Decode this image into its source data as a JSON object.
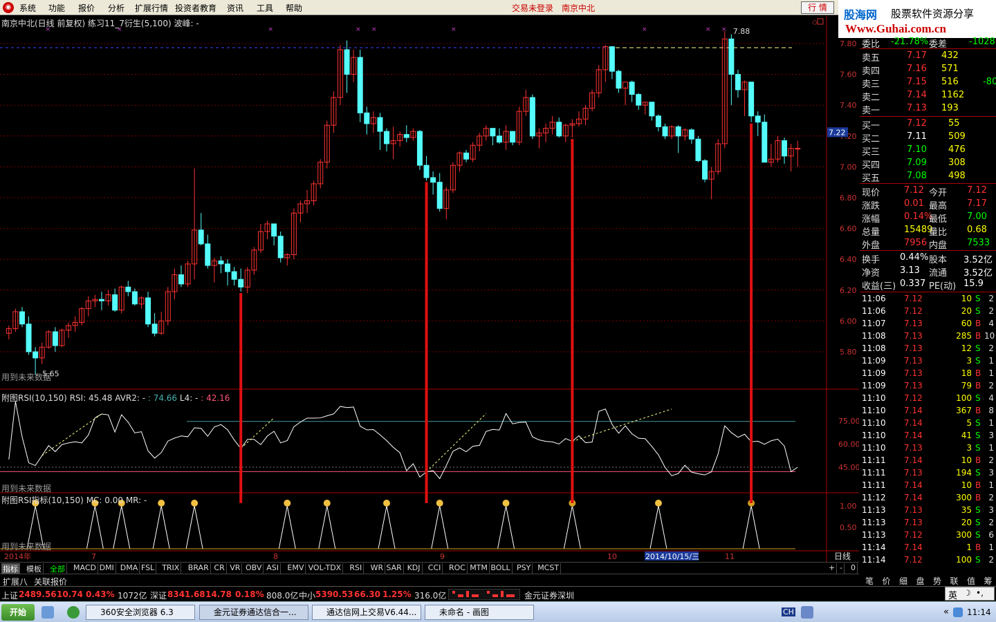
{
  "menubar": {
    "items": [
      "系统",
      "功能",
      "报价",
      "分析",
      "扩展行情",
      "投资者教育",
      "资讯",
      "工具",
      "帮助"
    ],
    "notice_login": "交易未登录",
    "notice_stock": "南京中北",
    "quote_button": "行 情"
  },
  "banner": {
    "site_name": "股海网",
    "slogan": "股票软件资源分享",
    "url": "Www.Guhai.com.cn"
  },
  "chart": {
    "title_stock": "南京中北(日线 前复权)",
    "title_formula": "练习11_7衍生(5,100)",
    "title_wave": "波峰: -",
    "future_note": "用到未来数据",
    "low_label": "5.65",
    "high_label": "7.88",
    "current_price_label": "7.22",
    "price_ticks": [
      "7.80",
      "7.60",
      "7.40",
      "7.20",
      "7.00",
      "6.80",
      "6.60",
      "6.40",
      "6.20",
      "6.00",
      "5.80"
    ],
    "rsi_title": "附图RSI(10,150)",
    "rsi_value_label": "RSI: 45.48",
    "rsi_avr2_label": "AVR2: - ",
    "rsi_avr2_value": ": 74.66",
    "rsi_l4_label": "L4: - ",
    "rsi_l4_value": ": 42.16",
    "rsi_ticks": [
      "75.00",
      "60.00",
      "45.00"
    ],
    "ind_title": "附图RSI指标(10,150)",
    "ind_mc": "MC: 0.00",
    "ind_mr": "MR: -",
    "ind_ticks": [
      "1.00",
      "0.50"
    ],
    "date_axis": [
      "2014年",
      "7",
      "8",
      "9",
      "10",
      "2014/10/15/三",
      "11"
    ],
    "period_label": "日线",
    "colors": {
      "up": "#ff3232",
      "down": "#54fcfc",
      "signal_line": "#e01010",
      "grid": "#7a0000"
    }
  },
  "chart_data": {
    "type": "candlestick",
    "candles": [
      [
        5.92,
        5.97,
        5.88,
        5.95
      ],
      [
        5.95,
        6.08,
        5.93,
        6.06
      ],
      [
        6.06,
        6.09,
        5.96,
        5.98
      ],
      [
        5.98,
        6.03,
        5.78,
        5.8
      ],
      [
        5.8,
        5.83,
        5.65,
        5.76
      ],
      [
        5.76,
        5.86,
        5.72,
        5.83
      ],
      [
        5.83,
        5.94,
        5.82,
        5.93
      ],
      [
        5.93,
        5.96,
        5.8,
        5.84
      ],
      [
        5.84,
        5.95,
        5.83,
        5.94
      ],
      [
        5.94,
        5.99,
        5.89,
        5.97
      ],
      [
        5.97,
        6.03,
        5.93,
        5.99
      ],
      [
        5.99,
        6.09,
        5.97,
        6.08
      ],
      [
        6.08,
        6.16,
        6.03,
        6.13
      ],
      [
        6.13,
        6.17,
        6.09,
        6.14
      ],
      [
        6.14,
        6.19,
        6.07,
        6.13
      ],
      [
        6.13,
        6.2,
        6.1,
        6.17
      ],
      [
        6.17,
        6.21,
        6.06,
        6.07
      ],
      [
        6.07,
        6.23,
        6.05,
        6.22
      ],
      [
        6.22,
        6.26,
        6.16,
        6.19
      ],
      [
        6.19,
        6.21,
        6.1,
        6.11
      ],
      [
        6.11,
        6.16,
        6.08,
        6.15
      ],
      [
        6.15,
        6.19,
        5.96,
        5.98
      ],
      [
        5.98,
        6.05,
        5.9,
        5.92
      ],
      [
        5.92,
        6.06,
        5.91,
        6.0
      ],
      [
        6.0,
        6.22,
        5.97,
        6.19
      ],
      [
        6.19,
        6.34,
        6.14,
        6.3
      ],
      [
        6.3,
        6.36,
        6.22,
        6.24
      ],
      [
        6.24,
        6.39,
        6.22,
        6.37
      ],
      [
        6.37,
        6.99,
        6.27,
        6.59
      ],
      [
        6.59,
        6.7,
        6.49,
        6.5
      ],
      [
        6.5,
        6.56,
        6.34,
        6.36
      ],
      [
        6.36,
        6.41,
        6.25,
        6.39
      ],
      [
        6.39,
        6.42,
        6.31,
        6.37
      ],
      [
        6.37,
        6.4,
        6.23,
        6.32
      ],
      [
        6.32,
        6.35,
        6.23,
        6.27
      ],
      [
        6.27,
        6.34,
        6.19,
        6.22
      ],
      [
        6.22,
        6.35,
        6.18,
        6.33
      ],
      [
        6.33,
        6.48,
        6.3,
        6.46
      ],
      [
        6.46,
        6.63,
        6.44,
        6.58
      ],
      [
        6.58,
        6.65,
        6.53,
        6.63
      ],
      [
        6.63,
        6.62,
        6.49,
        6.55
      ],
      [
        6.55,
        6.58,
        6.38,
        6.41
      ],
      [
        6.41,
        6.44,
        6.36,
        6.43
      ],
      [
        6.43,
        6.73,
        6.4,
        6.7
      ],
      [
        6.7,
        6.78,
        6.64,
        6.76
      ],
      [
        6.76,
        6.85,
        6.7,
        6.78
      ],
      [
        6.78,
        6.91,
        6.75,
        6.89
      ],
      [
        6.89,
        7.05,
        6.86,
        7.03
      ],
      [
        7.03,
        7.3,
        6.99,
        7.27
      ],
      [
        7.27,
        7.49,
        7.22,
        7.45
      ],
      [
        7.45,
        7.79,
        7.4,
        7.76
      ],
      [
        7.76,
        7.82,
        7.48,
        7.6
      ],
      [
        7.6,
        7.76,
        7.55,
        7.71
      ],
      [
        7.71,
        7.76,
        7.29,
        7.35
      ],
      [
        7.35,
        7.39,
        7.21,
        7.28
      ],
      [
        7.28,
        7.36,
        7.22,
        7.32
      ],
      [
        7.32,
        7.35,
        7.11,
        7.23
      ],
      [
        7.23,
        7.25,
        7.1,
        7.15
      ],
      [
        7.15,
        7.26,
        7.05,
        7.17
      ],
      [
        7.17,
        7.23,
        7.13,
        7.21
      ],
      [
        7.21,
        7.27,
        7.16,
        7.19
      ],
      [
        7.19,
        7.25,
        7.17,
        7.23
      ],
      [
        7.23,
        7.24,
        6.98,
        7.01
      ],
      [
        7.01,
        7.07,
        6.91,
        6.93
      ],
      [
        6.93,
        6.97,
        6.82,
        6.9
      ],
      [
        6.9,
        6.96,
        6.71,
        6.73
      ],
      [
        6.73,
        6.87,
        6.66,
        6.85
      ],
      [
        6.85,
        7.03,
        6.83,
        7.01
      ],
      [
        7.01,
        7.1,
        6.97,
        7.09
      ],
      [
        7.09,
        7.11,
        7.03,
        7.05
      ],
      [
        7.05,
        7.16,
        7.03,
        7.14
      ],
      [
        7.14,
        7.22,
        7.1,
        7.2
      ],
      [
        7.2,
        7.27,
        7.17,
        7.25
      ],
      [
        7.25,
        7.22,
        7.14,
        7.2
      ],
      [
        7.2,
        7.25,
        7.15,
        7.16
      ],
      [
        7.16,
        7.27,
        7.11,
        7.23
      ],
      [
        7.23,
        7.21,
        7.14,
        7.16
      ],
      [
        7.16,
        7.39,
        7.14,
        7.36
      ],
      [
        7.36,
        7.5,
        7.33,
        7.45
      ],
      [
        7.45,
        7.47,
        7.18,
        7.2
      ],
      [
        7.2,
        7.25,
        7.12,
        7.22
      ],
      [
        7.22,
        7.28,
        7.16,
        7.25
      ],
      [
        7.25,
        7.33,
        7.21,
        7.29
      ],
      [
        7.29,
        7.32,
        7.19,
        7.2
      ],
      [
        7.2,
        7.28,
        7.16,
        7.27
      ],
      [
        7.27,
        7.31,
        7.19,
        7.28
      ],
      [
        7.28,
        7.36,
        7.26,
        7.31
      ],
      [
        7.31,
        7.4,
        7.27,
        7.38
      ],
      [
        7.38,
        7.5,
        7.36,
        7.48
      ],
      [
        7.48,
        7.66,
        7.45,
        7.63
      ],
      [
        7.63,
        7.79,
        7.55,
        7.78
      ],
      [
        7.78,
        7.7,
        7.57,
        7.62
      ],
      [
        7.62,
        7.63,
        7.48,
        7.51
      ],
      [
        7.51,
        7.52,
        7.4,
        7.55
      ],
      [
        7.55,
        7.56,
        7.42,
        7.47
      ],
      [
        7.47,
        7.48,
        7.37,
        7.4
      ],
      [
        7.4,
        7.42,
        7.34,
        7.42
      ],
      [
        7.42,
        7.4,
        7.3,
        7.33
      ],
      [
        7.33,
        7.34,
        7.23,
        7.26
      ],
      [
        7.26,
        7.28,
        7.18,
        7.2
      ],
      [
        7.2,
        7.27,
        7.18,
        7.26
      ],
      [
        7.26,
        7.27,
        7.09,
        7.2
      ],
      [
        7.2,
        7.25,
        7.17,
        7.24
      ],
      [
        7.24,
        7.25,
        7.15,
        7.18
      ],
      [
        7.18,
        7.2,
        7.03,
        7.04
      ],
      [
        7.04,
        7.05,
        6.9,
        6.92
      ],
      [
        6.92,
        7.0,
        6.79,
        6.97
      ],
      [
        6.97,
        7.18,
        6.95,
        7.15
      ],
      [
        7.15,
        7.88,
        7.12,
        7.83
      ],
      [
        7.83,
        7.86,
        7.4,
        7.6
      ],
      [
        7.6,
        7.63,
        7.45,
        7.5
      ],
      [
        7.5,
        7.56,
        7.33,
        7.55
      ],
      [
        7.55,
        7.47,
        7.29,
        7.33
      ],
      [
        7.33,
        7.36,
        7.2,
        7.29
      ],
      [
        7.29,
        7.34,
        7.11,
        7.03
      ],
      [
        7.03,
        7.15,
        7.0,
        7.05
      ],
      [
        7.05,
        7.2,
        7.03,
        7.17
      ],
      [
        7.17,
        7.19,
        7.02,
        7.07
      ],
      [
        7.07,
        7.15,
        6.97,
        7.12
      ],
      [
        7.12,
        7.17,
        7.0,
        7.12
      ]
    ],
    "buy_signal_indices": [
      35,
      63,
      85,
      112
    ],
    "rsi_levels": {
      "upper": 74.66,
      "lower": 42.16
    }
  },
  "tabs": {
    "items": [
      "指标",
      "模板",
      "全部",
      "MACD",
      "DMI",
      "DMA",
      "FSL",
      "TRIX",
      "BRAR",
      "CR",
      "VR",
      "OBV",
      "ASI",
      "EMV",
      "VOL-TDX",
      "RSI",
      "WR",
      "SAR",
      "KDJ",
      "CCI",
      "ROC",
      "MTM",
      "BOLL",
      "PSY",
      "MCST"
    ],
    "row2": [
      "扩展八",
      "关联报价"
    ],
    "controls": [
      "+",
      "-",
      "0"
    ]
  },
  "quote_panel": {
    "header_label": "委比",
    "header_value": "-21.78%",
    "header_label2": "委差",
    "header_value2": "-1028",
    "asks": [
      {
        "label": "卖五",
        "price": "7.17",
        "vol": "432",
        "extra": ""
      },
      {
        "label": "卖四",
        "price": "7.16",
        "vol": "571",
        "extra": ""
      },
      {
        "label": "卖三",
        "price": "7.15",
        "vol": "516",
        "extra": "-80"
      },
      {
        "label": "卖二",
        "price": "7.14",
        "vol": "1162",
        "extra": ""
      },
      {
        "label": "卖一",
        "price": "7.13",
        "vol": "193",
        "extra": ""
      }
    ],
    "bids": [
      {
        "label": "买一",
        "price": "7.12",
        "vol": "55"
      },
      {
        "label": "买二",
        "price": "7.11",
        "vol": "509"
      },
      {
        "label": "买三",
        "price": "7.10",
        "vol": "476"
      },
      {
        "label": "买四",
        "price": "7.09",
        "vol": "308"
      },
      {
        "label": "买五",
        "price": "7.08",
        "vol": "498"
      }
    ],
    "stats": [
      {
        "l1": "现价",
        "v1": "7.12",
        "l2": "今开",
        "v2": "7.12"
      },
      {
        "l1": "涨跌",
        "v1": "0.01",
        "l2": "最高",
        "v2": "7.17"
      },
      {
        "l1": "涨幅",
        "v1": "0.14%",
        "l2": "最低",
        "v2": "7.00"
      },
      {
        "l1": "总量",
        "v1": "15489",
        "l2": "量比",
        "v2": "0.68"
      },
      {
        "l1": "外盘",
        "v1": "7956",
        "l2": "内盘",
        "v2": "7533"
      }
    ],
    "stats2": [
      {
        "l1": "换手",
        "v1": "0.44%",
        "l2": "股本",
        "v2": "3.52亿"
      },
      {
        "l1": "净资",
        "v1": "3.13",
        "l2": "流通",
        "v2": "3.52亿"
      },
      {
        "l1": "收益(三)",
        "v1": "0.337",
        "l2": "PE(动)",
        "v2": "15.9"
      }
    ],
    "ticks": [
      {
        "time": "11:06",
        "price": "7.12",
        "vol": "10",
        "side": "S",
        "n": "2"
      },
      {
        "time": "11:06",
        "price": "7.12",
        "vol": "20",
        "side": "S",
        "n": "2"
      },
      {
        "time": "11:07",
        "price": "7.13",
        "vol": "60",
        "side": "B",
        "n": "4"
      },
      {
        "time": "11:08",
        "price": "7.13",
        "vol": "285",
        "side": "B",
        "n": "10"
      },
      {
        "time": "11:08",
        "price": "7.13",
        "vol": "12",
        "side": "S",
        "n": "2"
      },
      {
        "time": "11:09",
        "price": "7.13",
        "vol": "3",
        "side": "S",
        "n": "1"
      },
      {
        "time": "11:09",
        "price": "7.13",
        "vol": "18",
        "side": "B",
        "n": "1"
      },
      {
        "time": "11:09",
        "price": "7.13",
        "vol": "79",
        "side": "B",
        "n": "2"
      },
      {
        "time": "11:10",
        "price": "7.12",
        "vol": "100",
        "side": "S",
        "n": "4"
      },
      {
        "time": "11:10",
        "price": "7.14",
        "vol": "367",
        "side": "B",
        "n": "8"
      },
      {
        "time": "11:10",
        "price": "7.14",
        "vol": "5",
        "side": "S",
        "n": "1"
      },
      {
        "time": "11:10",
        "price": "7.14",
        "vol": "41",
        "side": "S",
        "n": "3"
      },
      {
        "time": "11:10",
        "price": "7.13",
        "vol": "3",
        "side": "S",
        "n": "1"
      },
      {
        "time": "11:11",
        "price": "7.14",
        "vol": "10",
        "side": "B",
        "n": "2"
      },
      {
        "time": "11:11",
        "price": "7.13",
        "vol": "194",
        "side": "S",
        "n": "3"
      },
      {
        "time": "11:11",
        "price": "7.14",
        "vol": "10",
        "side": "B",
        "n": "1"
      },
      {
        "time": "11:12",
        "price": "7.14",
        "vol": "300",
        "side": "B",
        "n": "2"
      },
      {
        "time": "11:13",
        "price": "7.13",
        "vol": "35",
        "side": "S",
        "n": "3"
      },
      {
        "time": "11:13",
        "price": "7.13",
        "vol": "20",
        "side": "S",
        "n": "2"
      },
      {
        "time": "11:13",
        "price": "7.12",
        "vol": "300",
        "side": "S",
        "n": "6"
      },
      {
        "time": "11:14",
        "price": "7.14",
        "vol": "1",
        "side": "B",
        "n": "1"
      },
      {
        "time": "11:14",
        "price": "7.12",
        "vol": "100",
        "side": "S",
        "n": "2"
      }
    ],
    "bottom_tabs": [
      "笔",
      "价",
      "细",
      "盘",
      "势",
      "联",
      "值",
      "筹"
    ]
  },
  "statusbar": {
    "sh_label": "上证",
    "sh_index": "2489.56",
    "sh_change": "10.74",
    "sh_pct": "0.43%",
    "sh_amount": "1072亿",
    "sz_label": "深证",
    "sz_index": "8341.68",
    "sz_change": "14.78",
    "sz_pct": "0.18%",
    "sz_amount": "808.0亿",
    "zx_label": "中小",
    "zx_index": "5390.53",
    "zx_change": "66.30",
    "zx_pct": "1.25%",
    "zx_amount": "316.0亿",
    "broker": "金元证券深圳"
  },
  "ime": {
    "label": "英"
  },
  "taskbar": {
    "start": "开始",
    "tasks": [
      "360安全浏览器 6.3",
      "金元证券通达信合一...",
      "通达信网上交易V6.44...",
      "未命名 - 画图"
    ],
    "tray_ch": "CH",
    "clock": "11:14"
  }
}
